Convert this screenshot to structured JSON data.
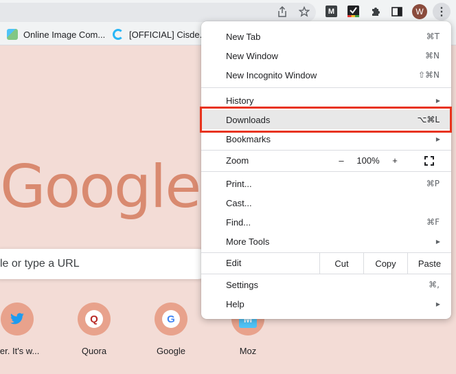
{
  "toolbar": {
    "share_icon": "share-icon",
    "star_icon": "star-icon",
    "extensions": [
      "m-extension-icon",
      "checklist-extension-icon",
      "puzzle-icon",
      "side-panel-icon"
    ],
    "m_glyph": "M",
    "avatar_letter": "W",
    "menu_glyph": "⋮"
  },
  "bookmarks": [
    {
      "label": "Online Image Com...",
      "icon": "image-compressor-favicon"
    },
    {
      "label": "[OFFICIAL] Cisde...",
      "icon": "cisdem-favicon"
    }
  ],
  "ntp": {
    "logo_text": "Google",
    "search_placeholder": "le or type a URL",
    "shortcuts": [
      {
        "label": "tter. It's w...",
        "glyph": "🐦",
        "icon": "twitter-icon"
      },
      {
        "label": "Quora",
        "glyph": "Q",
        "icon": "quora-icon"
      },
      {
        "label": "Google",
        "glyph": "G",
        "icon": "google-icon"
      },
      {
        "label": "Moz",
        "glyph": "M",
        "icon": "moz-icon"
      }
    ]
  },
  "menu": {
    "new_tab": {
      "label": "New Tab",
      "shortcut": "⌘T"
    },
    "new_window": {
      "label": "New Window",
      "shortcut": "⌘N"
    },
    "new_incognito": {
      "label": "New Incognito Window",
      "shortcut": "⇧⌘N"
    },
    "history": {
      "label": "History",
      "arrow": "▶"
    },
    "downloads": {
      "label": "Downloads",
      "shortcut": "⌥⌘L"
    },
    "bookmarks": {
      "label": "Bookmarks",
      "arrow": "▶"
    },
    "zoom": {
      "label": "Zoom",
      "minus": "–",
      "level": "100%",
      "plus": "+"
    },
    "print": {
      "label": "Print...",
      "shortcut": "⌘P"
    },
    "cast": {
      "label": "Cast..."
    },
    "find": {
      "label": "Find...",
      "shortcut": "⌘F"
    },
    "more_tools": {
      "label": "More Tools",
      "arrow": "▶"
    },
    "edit": {
      "label": "Edit",
      "cut": "Cut",
      "copy": "Copy",
      "paste": "Paste"
    },
    "settings": {
      "label": "Settings",
      "shortcut": "⌘,"
    },
    "help": {
      "label": "Help",
      "arrow": "▶"
    }
  },
  "colors": {
    "highlight_border": "#e8331c",
    "ntp_background": "#f3dcd6",
    "logo": "#d98a70"
  }
}
